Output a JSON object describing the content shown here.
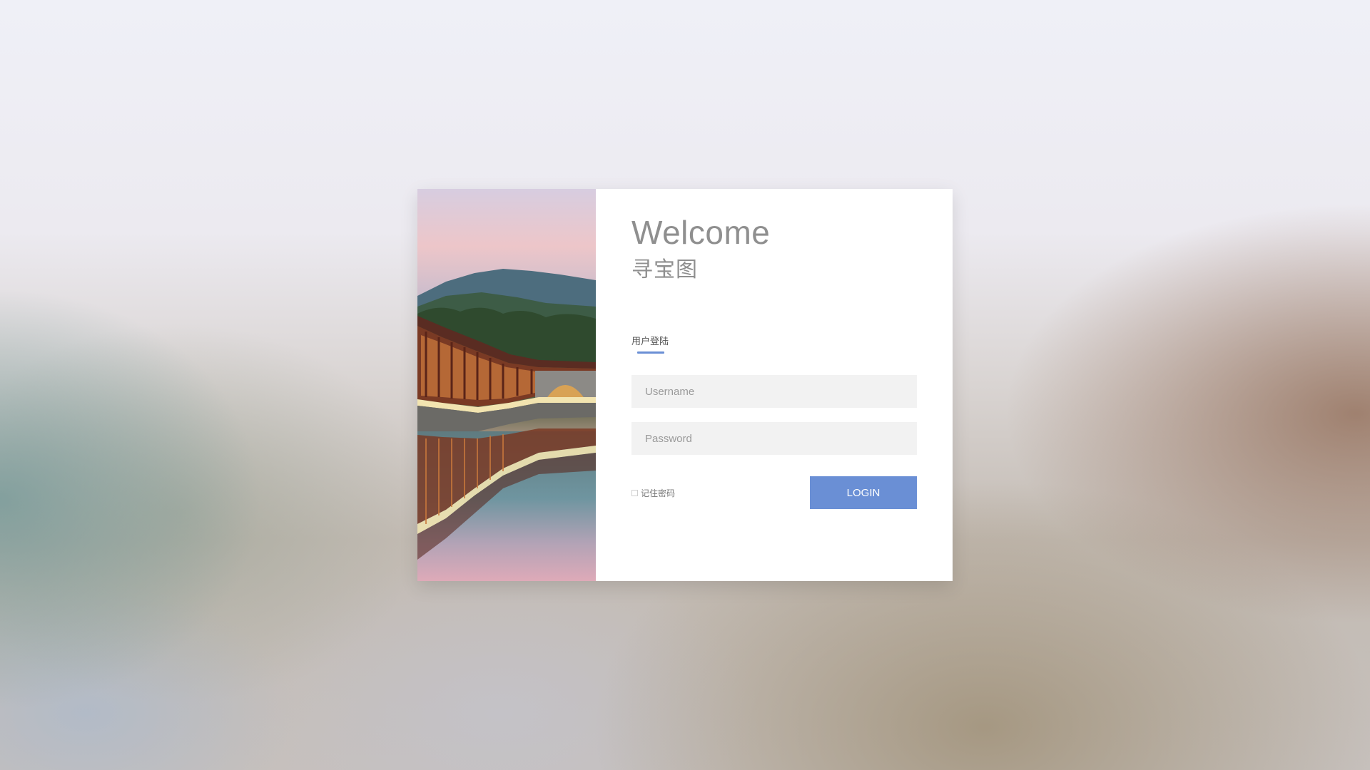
{
  "page": {
    "background_colors": [
      "#eff0f7",
      "#c3bbb3",
      "#9aa9a5"
    ]
  },
  "card": {
    "image_name": "bridge-landscape-photo",
    "welcome_title": "Welcome",
    "welcome_subtitle": "寻宝图",
    "tab_label": "用户登陆",
    "accent_color": "#6a8fd5",
    "username_placeholder": "Username",
    "password_placeholder": "Password",
    "remember_label": "记住密码",
    "login_label": "LOGIN"
  }
}
